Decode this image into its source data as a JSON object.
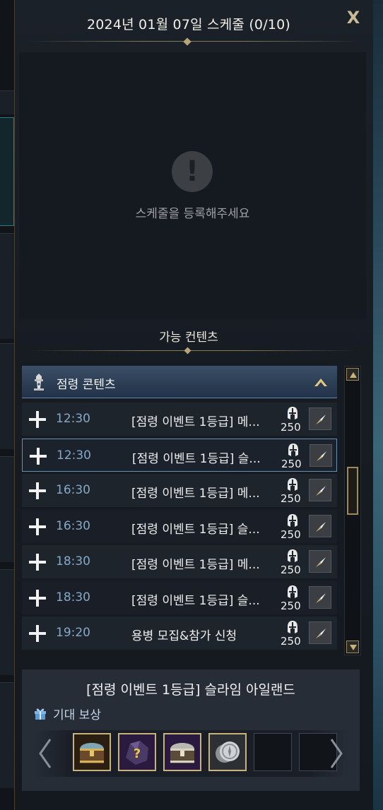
{
  "panel": {
    "title": "2024년 01월 07일 스케줄 (0/10)",
    "close_label": "X"
  },
  "schedule": {
    "empty_icon": "!",
    "empty_text": "스케줄을 등록해주세요"
  },
  "available": {
    "section_title": "가능 컨텐츠",
    "category": {
      "label": "점령 콘텐츠",
      "icon": "tower-icon",
      "expanded": true
    },
    "items": [
      {
        "time": "12:30",
        "name": "[점령 이벤트 1등급] 메...",
        "cost": "250",
        "selected": false
      },
      {
        "time": "12:30",
        "name": "[점령 이벤트 1등급] 슬...",
        "cost": "250",
        "selected": true
      },
      {
        "time": "16:30",
        "name": "[점령 이벤트 1등급] 메...",
        "cost": "250",
        "selected": false
      },
      {
        "time": "16:30",
        "name": "[점령 이벤트 1등급] 슬...",
        "cost": "250",
        "selected": false
      },
      {
        "time": "18:30",
        "name": "[점령 이벤트 1등급] 메...",
        "cost": "250",
        "selected": false
      },
      {
        "time": "18:30",
        "name": "[점령 이벤트 1등급] 슬...",
        "cost": "250",
        "selected": false
      },
      {
        "time": "19:20",
        "name": "용병 모집&참가 신청",
        "cost": "250",
        "selected": false
      }
    ],
    "scroll_position": 0.4
  },
  "detail": {
    "title": "[점령 이벤트 1등급] 슬라임 아일랜드",
    "reward_label": "기대 보상",
    "rewards": [
      {
        "icon": "gold-chest-icon",
        "frame": "gold"
      },
      {
        "icon": "mystery-ore-icon",
        "frame": "purple"
      },
      {
        "icon": "silver-chest-icon",
        "frame": "purple"
      },
      {
        "icon": "silver-coin-icon",
        "frame": "grey"
      },
      {
        "icon": "empty-slot",
        "frame": "empty"
      },
      {
        "icon": "empty-slot",
        "frame": "empty"
      }
    ]
  },
  "colors": {
    "accent_gold": "#c9b37c",
    "time_blue": "#86a8c8",
    "selected_border": "#6a8fb7"
  }
}
